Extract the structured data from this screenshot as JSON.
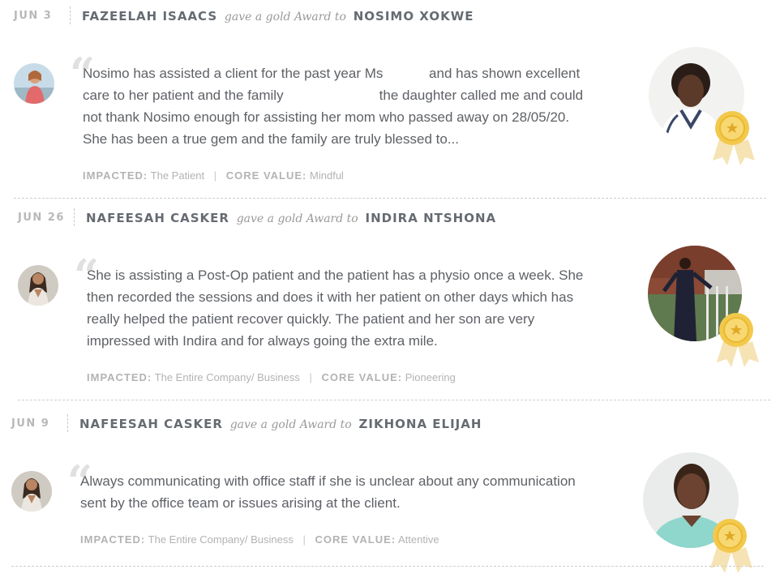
{
  "award_word": "gave a gold Award to",
  "labels": {
    "impacted": "IMPACTED:",
    "core_value": "CORE VALUE:"
  },
  "colors": {
    "medal_gold": "#f2c94c",
    "ribbon": "#f6e3b4",
    "text": "#5e6166",
    "muted": "#b3b3b3"
  },
  "entries": [
    {
      "date": "JUN 3",
      "giver": "FAZEELAH ISAACS",
      "receiver": "NOSIMO XOKWE",
      "message_lines": [
        "Nosimo has assisted a client for the past year Ms            and has shown excellent",
        "care to her patient and the family                         the daughter called me and could",
        "not thank Nosimo enough for assisting her mom who passed away on 28/05/20.",
        "She has been a true gem and the family are truly blessed to..."
      ],
      "impacted": "The Patient",
      "core_value": "Mindful",
      "giver_avatar_icon": "person-photo-icon",
      "receiver_photo_icon": "person-photo-icon"
    },
    {
      "date": "JUN 26",
      "giver": "NAFEESAH CASKER",
      "receiver": "INDIRA NTSHONA",
      "message_lines": [
        "She is assisting a Post-Op patient and the patient has a physio once a week. She",
        "then recorded the sessions and does it with her patient on other days which has",
        "really helped the patient recover quickly. The patient and her son are very",
        "impressed with Indira and for always going the extra mile."
      ],
      "impacted": "The Entire Company/ Business",
      "core_value": "Pioneering",
      "giver_avatar_icon": "person-photo-icon",
      "receiver_photo_icon": "person-photo-icon"
    },
    {
      "date": "JUN 9",
      "giver": "NAFEESAH CASKER",
      "receiver": "ZIKHONA ELIJAH",
      "message_lines": [
        "Always communicating with office staff if she is unclear about any communication",
        "sent by the office team or issues arising at the client."
      ],
      "impacted": "The Entire Company/ Business",
      "core_value": "Attentive",
      "giver_avatar_icon": "person-photo-icon",
      "receiver_photo_icon": "person-photo-icon"
    }
  ]
}
